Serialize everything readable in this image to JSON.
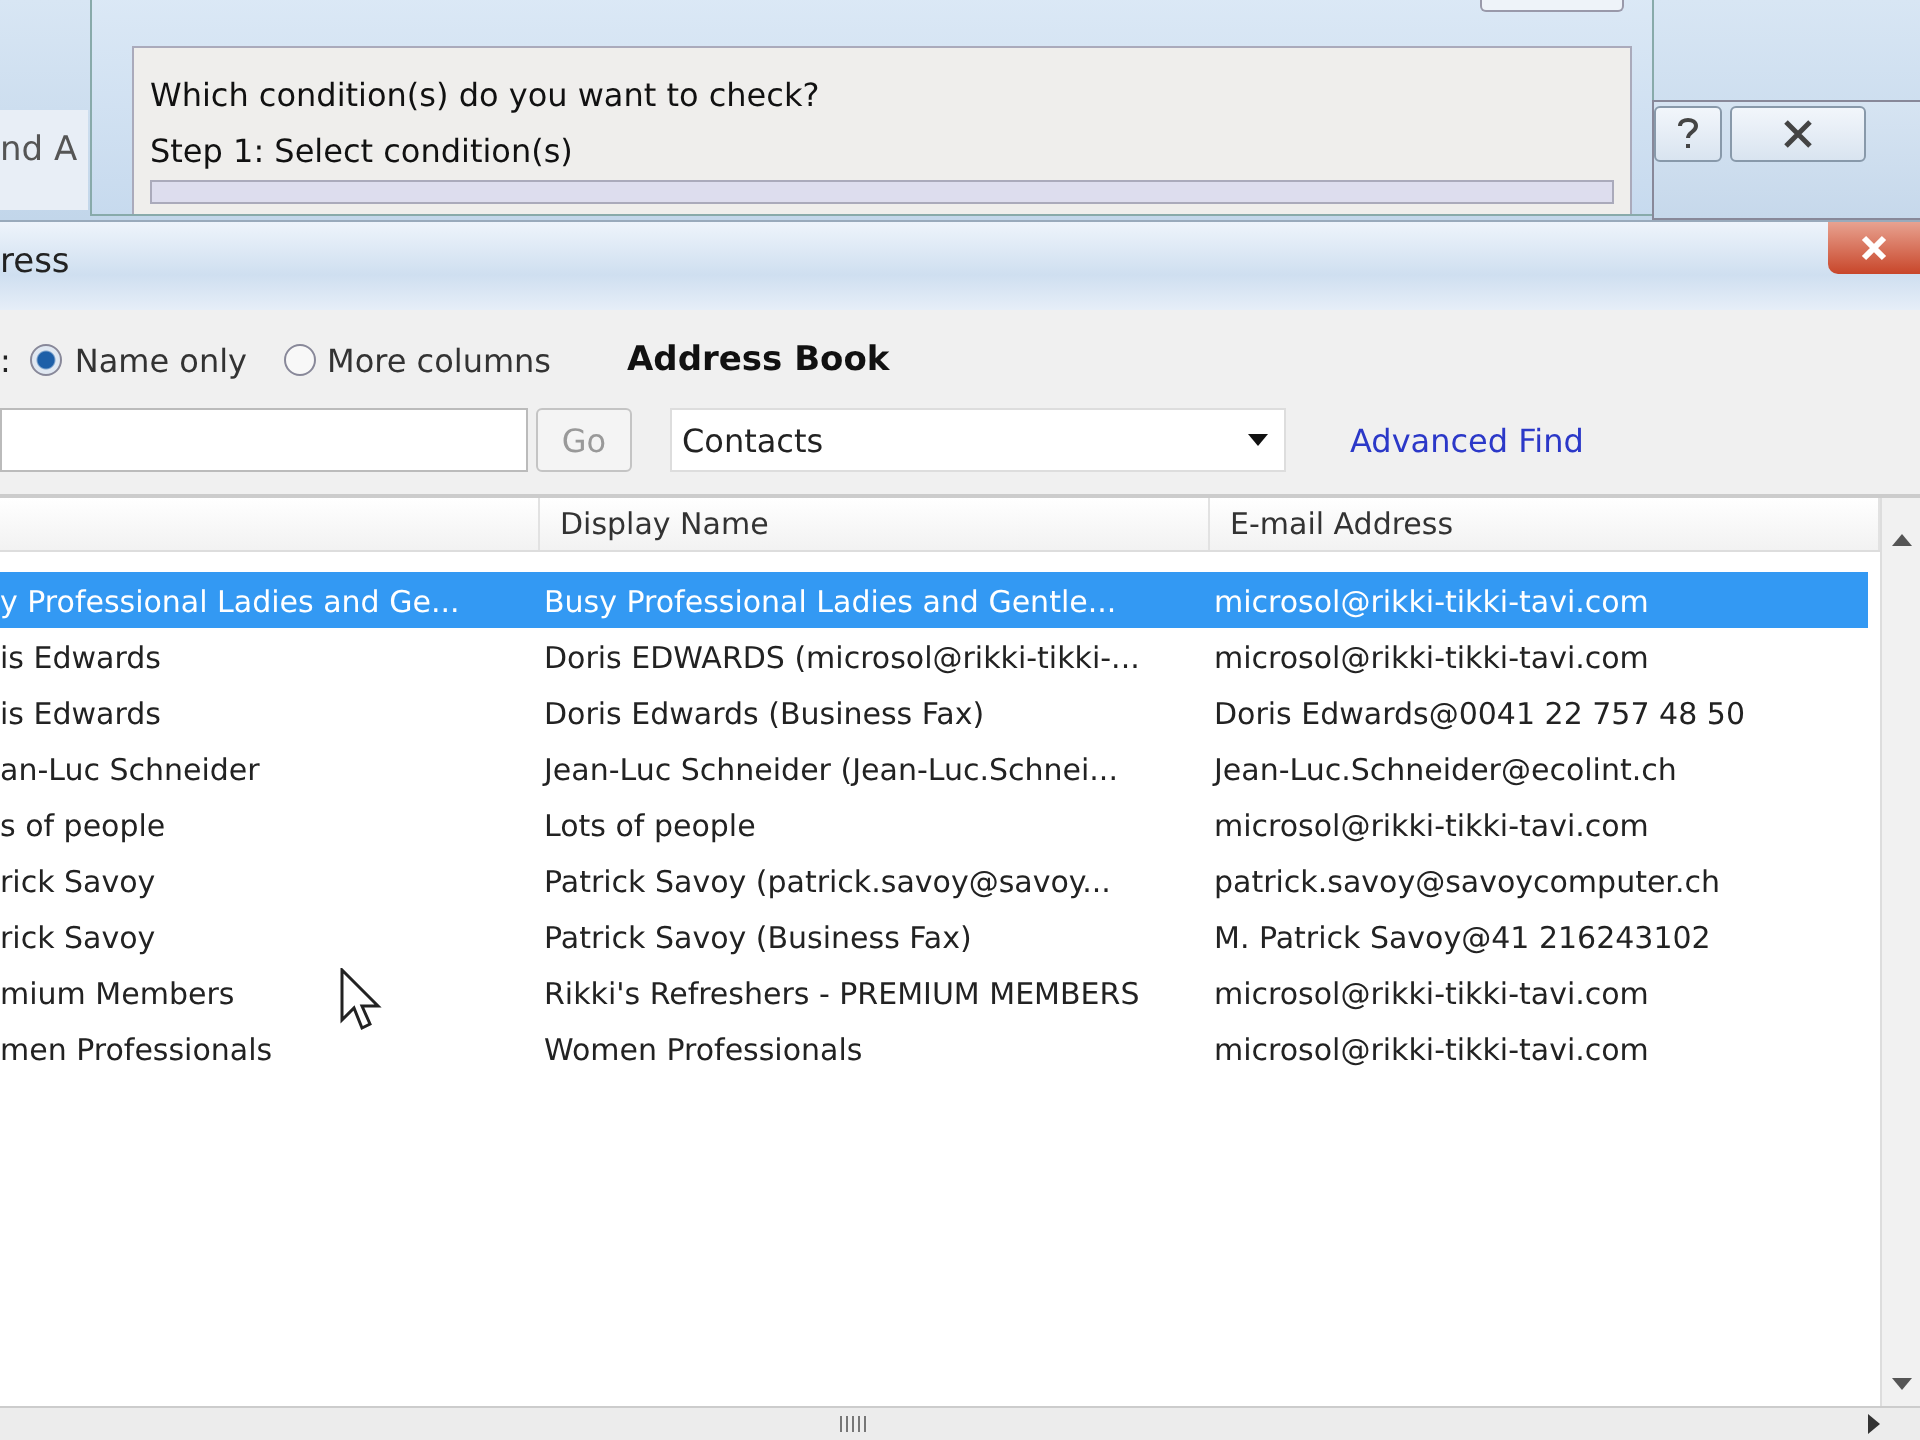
{
  "background_windows": {
    "left_fragment": "nd A",
    "wizard": {
      "question": "Which condition(s) do you want to check?",
      "step": "Step 1: Select condition(s)"
    }
  },
  "window": {
    "title": "ress"
  },
  "search": {
    "label": ":",
    "options": [
      {
        "label": "Name only",
        "selected": true
      },
      {
        "label": "More columns",
        "selected": false
      }
    ],
    "go_button": "Go",
    "address_book_label": "Address Book",
    "address_book": "Contacts",
    "advanced_find": "Advanced Find"
  },
  "table": {
    "columns": [
      "",
      "Display Name",
      "E-mail Address"
    ],
    "rows": [
      {
        "cells": [
          "y Professional Ladies and Ge...",
          "Busy Professional Ladies and Gentle...",
          "microsol@rikki-tikki-tavi.com"
        ],
        "selected": true
      },
      {
        "cells": [
          "is Edwards",
          "Doris EDWARDS (microsol@rikki-tikki-...",
          "microsol@rikki-tikki-tavi.com"
        ],
        "selected": false
      },
      {
        "cells": [
          "is Edwards",
          "Doris Edwards (Business Fax)",
          "Doris Edwards@0041 22 757 48 50"
        ],
        "selected": false
      },
      {
        "cells": [
          "an-Luc Schneider",
          "Jean-Luc Schneider (Jean-Luc.Schnei...",
          "Jean-Luc.Schneider@ecolint.ch"
        ],
        "selected": false
      },
      {
        "cells": [
          "s of people",
          "Lots of people",
          "microsol@rikki-tikki-tavi.com"
        ],
        "selected": false
      },
      {
        "cells": [
          "rick Savoy",
          "Patrick Savoy (patrick.savoy@savoy...",
          "patrick.savoy@savoycomputer.ch"
        ],
        "selected": false
      },
      {
        "cells": [
          "rick Savoy",
          "Patrick Savoy (Business Fax)",
          "M. Patrick Savoy@41 216243102"
        ],
        "selected": false
      },
      {
        "cells": [
          "mium Members",
          "Rikki's Refreshers - PREMIUM MEMBERS",
          "microsol@rikki-tikki-tavi.com"
        ],
        "selected": false
      },
      {
        "cells": [
          "men Professionals",
          "Women Professionals",
          "microsol@rikki-tikki-tavi.com"
        ],
        "selected": false
      }
    ]
  }
}
